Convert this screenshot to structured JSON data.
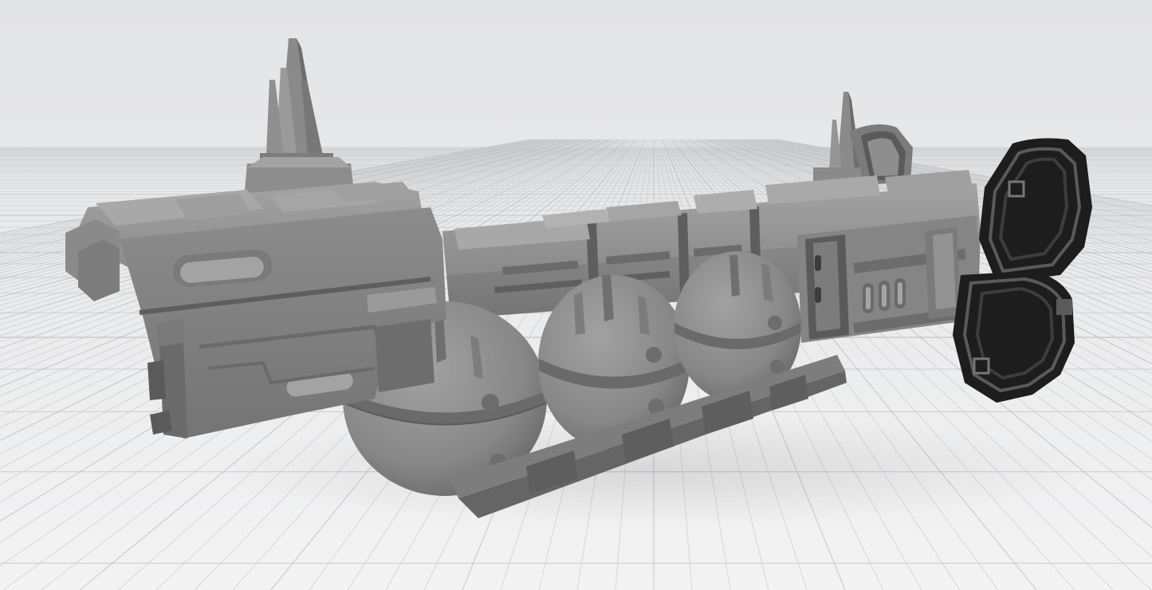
{
  "viewport": {
    "kind": "3d-model-viewer",
    "background_top": "#e4e5e7",
    "background_bottom": "#f1f1f2",
    "grid": true,
    "grid_color": "#c9cacc",
    "grid_major_color": "#b3b4b6"
  },
  "model": {
    "subject": "starship",
    "primary_color": "#8e8e8e",
    "light_color": "#a4a4a4",
    "dark_color": "#6a6a6a",
    "shadow_color": "#2a2a2a",
    "tank_count": 3,
    "antenna_count": 2,
    "engine_color": "#1c1c1c"
  }
}
